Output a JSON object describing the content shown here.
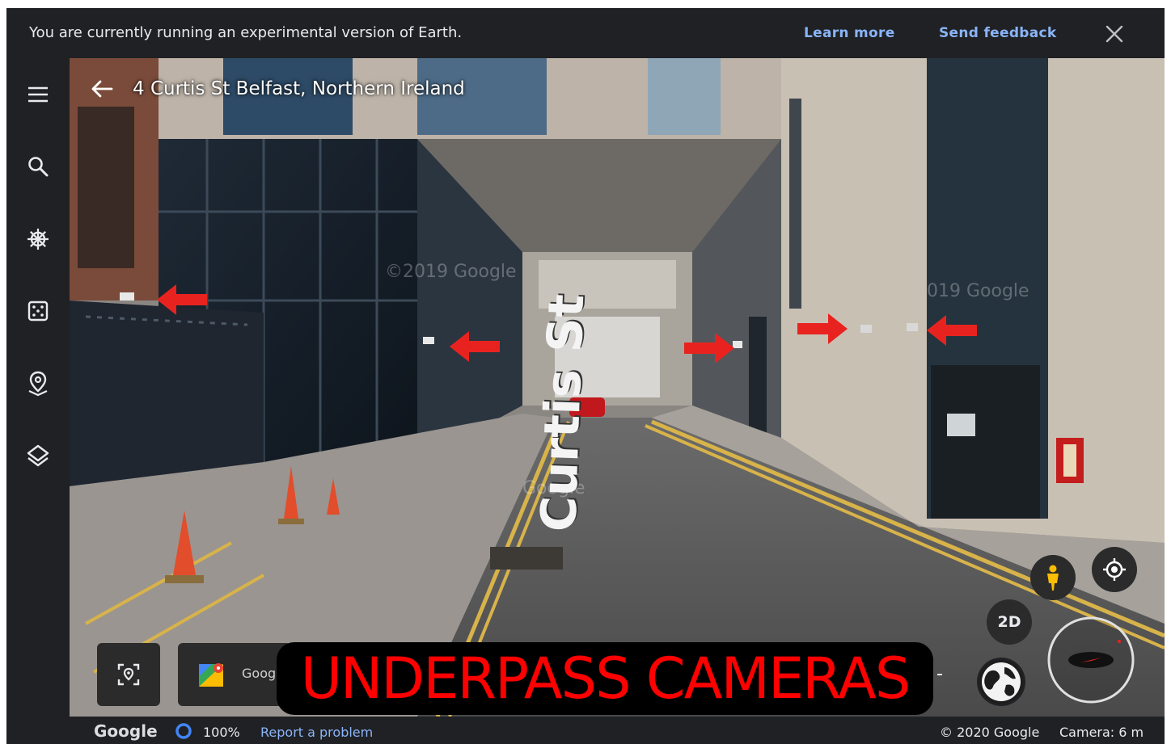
{
  "banner": {
    "message": "You are currently running an experimental version of Earth.",
    "learn_more": "Learn more",
    "send_feedback": "Send feedback"
  },
  "sidebar": {
    "items": [
      {
        "name": "menu",
        "icon": "menu-icon"
      },
      {
        "name": "search",
        "icon": "search-icon"
      },
      {
        "name": "voyager",
        "icon": "ship-wheel-icon"
      },
      {
        "name": "feeling-lucky",
        "icon": "dice-icon"
      },
      {
        "name": "projects",
        "icon": "map-pin-icon"
      },
      {
        "name": "map-style",
        "icon": "layers-icon"
      }
    ]
  },
  "location": {
    "address": "4 Curtis St Belfast, Northern Ireland"
  },
  "scene": {
    "watermark_1": "©2019 Google",
    "watermark_2": "019 Google",
    "watermark_3": "Google",
    "street_label": "Curtis St",
    "arrow_color": "#e8231f"
  },
  "overlay": {
    "caption": "UNDERPASS CAMERAS",
    "caption_color": "#ff0000"
  },
  "controls": {
    "maps_card_label": "Goog",
    "twod_label": "2D",
    "minus_label": "-"
  },
  "status": {
    "logo": "Google",
    "zoom_percent": "100%",
    "report": "Report a problem",
    "copyright": "© 2020 Google",
    "camera": "Camera: 6 m"
  },
  "colors": {
    "panel": "#202124",
    "link": "#8ab4f8",
    "text": "#e8eaed"
  }
}
